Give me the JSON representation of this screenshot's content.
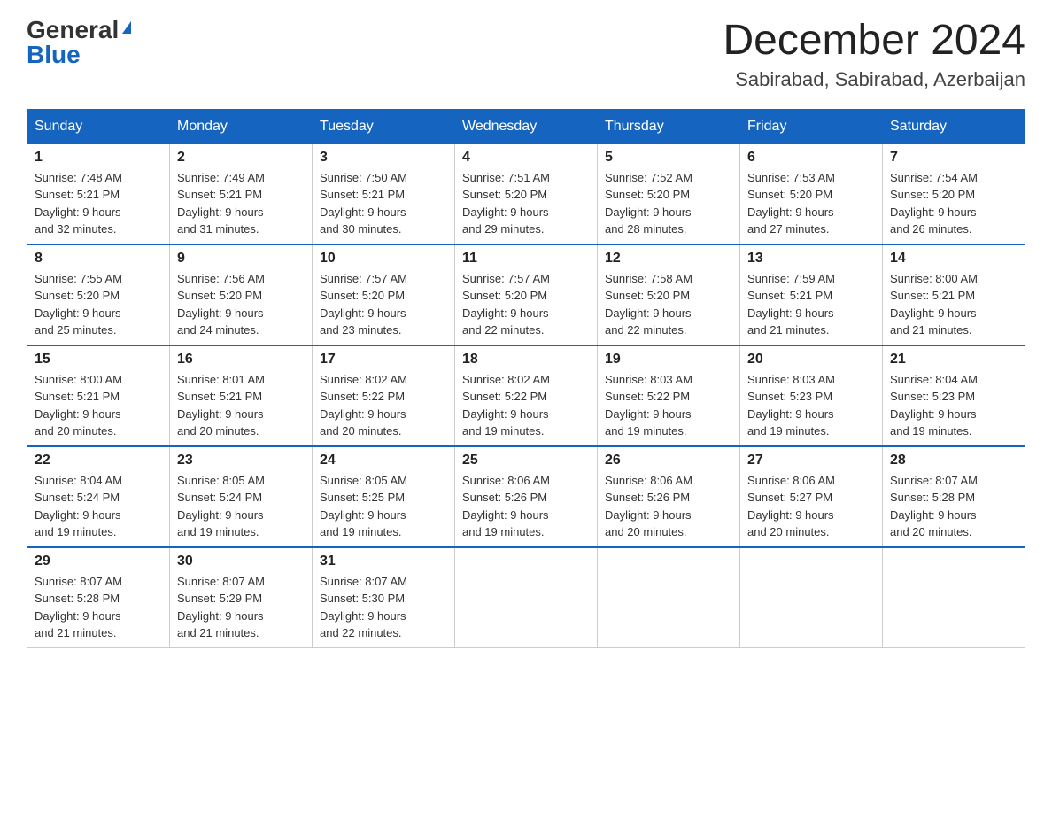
{
  "logo": {
    "general": "General",
    "blue": "Blue"
  },
  "title": "December 2024",
  "location": "Sabirabad, Sabirabad, Azerbaijan",
  "days_of_week": [
    "Sunday",
    "Monday",
    "Tuesday",
    "Wednesday",
    "Thursday",
    "Friday",
    "Saturday"
  ],
  "weeks": [
    [
      {
        "day": "1",
        "sunrise": "7:48 AM",
        "sunset": "5:21 PM",
        "daylight": "9 hours and 32 minutes."
      },
      {
        "day": "2",
        "sunrise": "7:49 AM",
        "sunset": "5:21 PM",
        "daylight": "9 hours and 31 minutes."
      },
      {
        "day": "3",
        "sunrise": "7:50 AM",
        "sunset": "5:21 PM",
        "daylight": "9 hours and 30 minutes."
      },
      {
        "day": "4",
        "sunrise": "7:51 AM",
        "sunset": "5:20 PM",
        "daylight": "9 hours and 29 minutes."
      },
      {
        "day": "5",
        "sunrise": "7:52 AM",
        "sunset": "5:20 PM",
        "daylight": "9 hours and 28 minutes."
      },
      {
        "day": "6",
        "sunrise": "7:53 AM",
        "sunset": "5:20 PM",
        "daylight": "9 hours and 27 minutes."
      },
      {
        "day": "7",
        "sunrise": "7:54 AM",
        "sunset": "5:20 PM",
        "daylight": "9 hours and 26 minutes."
      }
    ],
    [
      {
        "day": "8",
        "sunrise": "7:55 AM",
        "sunset": "5:20 PM",
        "daylight": "9 hours and 25 minutes."
      },
      {
        "day": "9",
        "sunrise": "7:56 AM",
        "sunset": "5:20 PM",
        "daylight": "9 hours and 24 minutes."
      },
      {
        "day": "10",
        "sunrise": "7:57 AM",
        "sunset": "5:20 PM",
        "daylight": "9 hours and 23 minutes."
      },
      {
        "day": "11",
        "sunrise": "7:57 AM",
        "sunset": "5:20 PM",
        "daylight": "9 hours and 22 minutes."
      },
      {
        "day": "12",
        "sunrise": "7:58 AM",
        "sunset": "5:20 PM",
        "daylight": "9 hours and 22 minutes."
      },
      {
        "day": "13",
        "sunrise": "7:59 AM",
        "sunset": "5:21 PM",
        "daylight": "9 hours and 21 minutes."
      },
      {
        "day": "14",
        "sunrise": "8:00 AM",
        "sunset": "5:21 PM",
        "daylight": "9 hours and 21 minutes."
      }
    ],
    [
      {
        "day": "15",
        "sunrise": "8:00 AM",
        "sunset": "5:21 PM",
        "daylight": "9 hours and 20 minutes."
      },
      {
        "day": "16",
        "sunrise": "8:01 AM",
        "sunset": "5:21 PM",
        "daylight": "9 hours and 20 minutes."
      },
      {
        "day": "17",
        "sunrise": "8:02 AM",
        "sunset": "5:22 PM",
        "daylight": "9 hours and 20 minutes."
      },
      {
        "day": "18",
        "sunrise": "8:02 AM",
        "sunset": "5:22 PM",
        "daylight": "9 hours and 19 minutes."
      },
      {
        "day": "19",
        "sunrise": "8:03 AM",
        "sunset": "5:22 PM",
        "daylight": "9 hours and 19 minutes."
      },
      {
        "day": "20",
        "sunrise": "8:03 AM",
        "sunset": "5:23 PM",
        "daylight": "9 hours and 19 minutes."
      },
      {
        "day": "21",
        "sunrise": "8:04 AM",
        "sunset": "5:23 PM",
        "daylight": "9 hours and 19 minutes."
      }
    ],
    [
      {
        "day": "22",
        "sunrise": "8:04 AM",
        "sunset": "5:24 PM",
        "daylight": "9 hours and 19 minutes."
      },
      {
        "day": "23",
        "sunrise": "8:05 AM",
        "sunset": "5:24 PM",
        "daylight": "9 hours and 19 minutes."
      },
      {
        "day": "24",
        "sunrise": "8:05 AM",
        "sunset": "5:25 PM",
        "daylight": "9 hours and 19 minutes."
      },
      {
        "day": "25",
        "sunrise": "8:06 AM",
        "sunset": "5:26 PM",
        "daylight": "9 hours and 19 minutes."
      },
      {
        "day": "26",
        "sunrise": "8:06 AM",
        "sunset": "5:26 PM",
        "daylight": "9 hours and 20 minutes."
      },
      {
        "day": "27",
        "sunrise": "8:06 AM",
        "sunset": "5:27 PM",
        "daylight": "9 hours and 20 minutes."
      },
      {
        "day": "28",
        "sunrise": "8:07 AM",
        "sunset": "5:28 PM",
        "daylight": "9 hours and 20 minutes."
      }
    ],
    [
      {
        "day": "29",
        "sunrise": "8:07 AM",
        "sunset": "5:28 PM",
        "daylight": "9 hours and 21 minutes."
      },
      {
        "day": "30",
        "sunrise": "8:07 AM",
        "sunset": "5:29 PM",
        "daylight": "9 hours and 21 minutes."
      },
      {
        "day": "31",
        "sunrise": "8:07 AM",
        "sunset": "5:30 PM",
        "daylight": "9 hours and 22 minutes."
      },
      null,
      null,
      null,
      null
    ]
  ],
  "labels": {
    "sunrise": "Sunrise:",
    "sunset": "Sunset:",
    "daylight": "Daylight:"
  }
}
